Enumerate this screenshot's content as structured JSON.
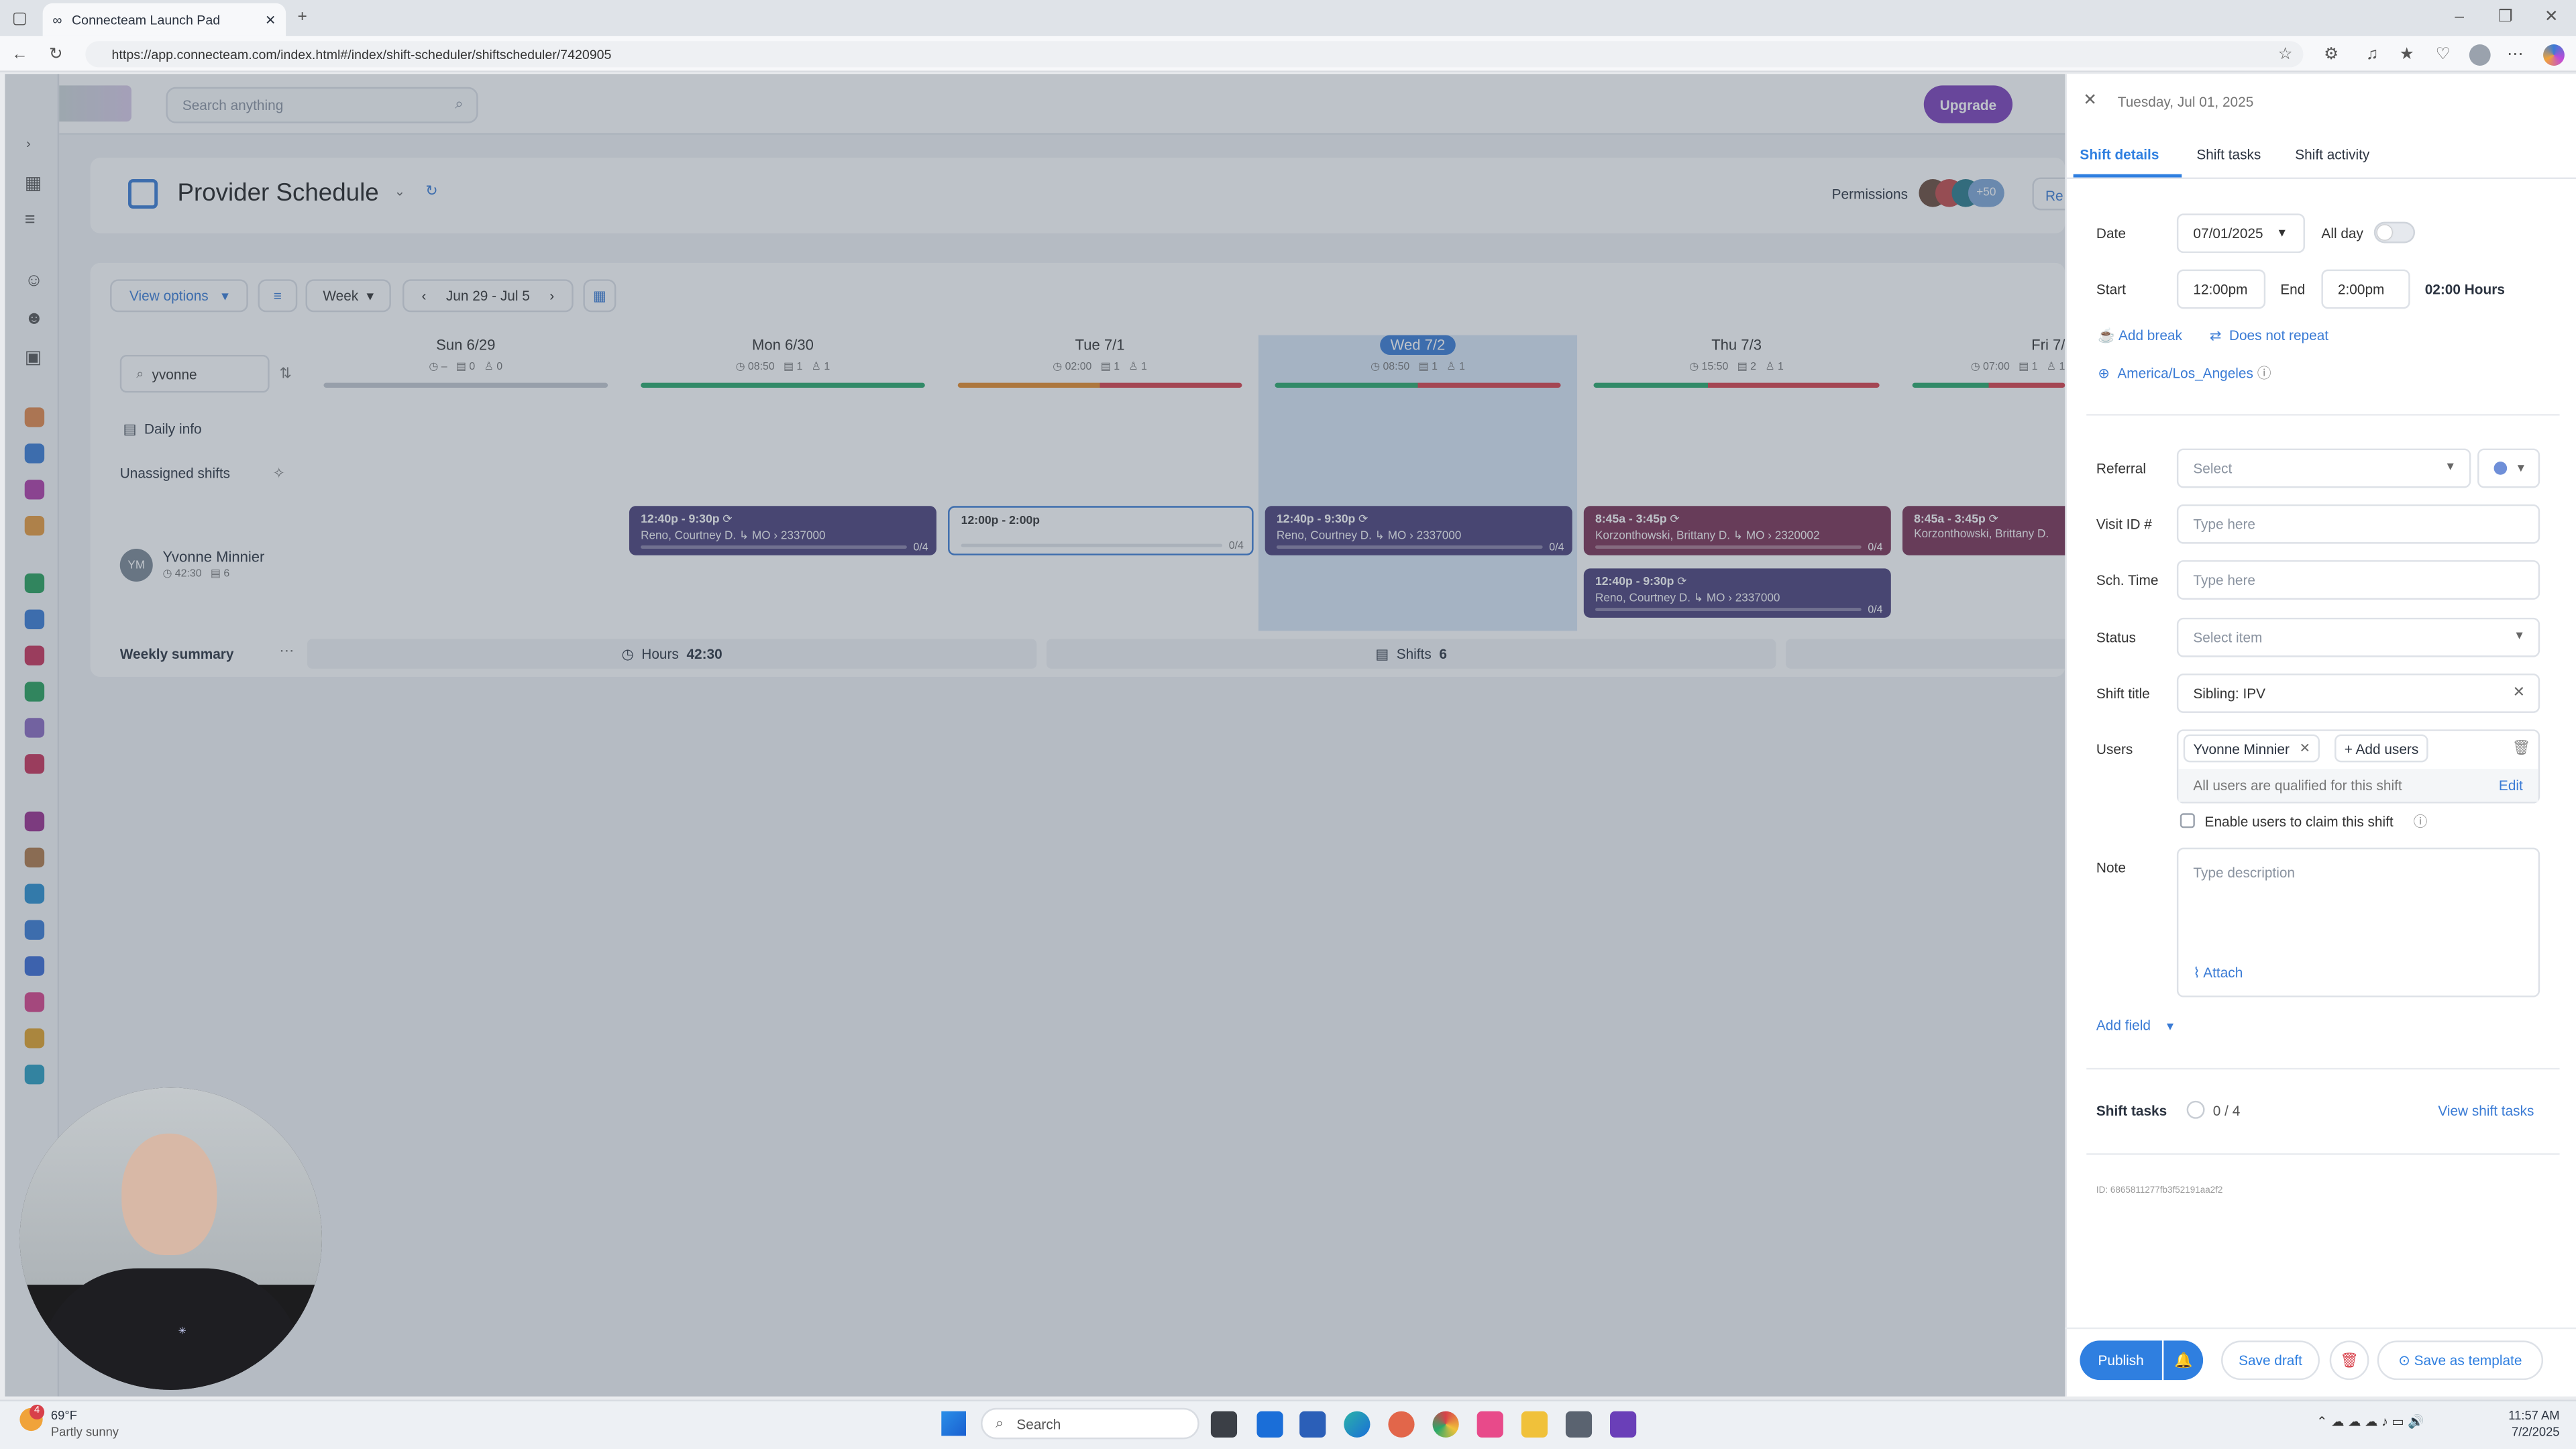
{
  "browser": {
    "tab_title": "Connecteam Launch Pad",
    "url": "https://app.connecteam.com/index.html#/index/shift-scheduler/shiftscheduler/7420905"
  },
  "app": {
    "search_placeholder": "Search anything",
    "upgrade_label": "Upgrade",
    "schedule_title": "Provider Schedule",
    "permissions_label": "Permissions",
    "permissions_more": "+50",
    "view_options_label": "View options",
    "week_label": "Week",
    "date_range": "Jun 29 - Jul 5",
    "user_search_value": "yvonne",
    "daily_info_label": "Daily info",
    "unassigned_label": "Unassigned shifts",
    "user_name": "Yvonne Minnier",
    "user_initials": "YM",
    "user_hours": "42:30",
    "user_shifts": "6",
    "weekly_summary_label": "Weekly summary",
    "hours_label": "Hours",
    "hours_value": "42:30",
    "shifts_label": "Shifts",
    "shifts_value": "6",
    "days": [
      {
        "label": "Sun 6/29",
        "hours": "–",
        "shifts": "0",
        "users": "0"
      },
      {
        "label": "Mon 6/30",
        "hours": "08:50",
        "shifts": "1",
        "users": "1"
      },
      {
        "label": "Tue 7/1",
        "hours": "02:00",
        "shifts": "1",
        "users": "1"
      },
      {
        "label": "Wed 7/2",
        "hours": "08:50",
        "shifts": "1",
        "users": "1"
      },
      {
        "label": "Thu 7/3",
        "hours": "15:50",
        "shifts": "2",
        "users": "1"
      },
      {
        "label": "Fri 7/",
        "hours": "07:00",
        "shifts": "1",
        "users": "1"
      }
    ],
    "shifts": [
      {
        "time": "12:40p - 9:30p",
        "desc": "Reno, Courtney D. ↳ MO › 2337000",
        "count": "0/4"
      },
      {
        "time": "12:00p - 2:00p",
        "desc": "",
        "count": "0/4"
      },
      {
        "time": "12:40p - 9:30p",
        "desc": "Reno, Courtney D. ↳ MO › 2337000",
        "count": "0/4"
      },
      {
        "time": "8:45a - 3:45p",
        "desc": "Korzonthowski, Brittany D. ↳ MO › 2320002",
        "count": "0/4"
      },
      {
        "time": "12:40p - 9:30p",
        "desc": "Reno, Courtney D. ↳ MO › 2337000",
        "count": "0/4"
      },
      {
        "time": "8:45a - 3:45p",
        "desc": "Korzonthowski, Brittany D.",
        "count": ""
      }
    ]
  },
  "panel": {
    "header_date": "Tuesday, Jul 01, 2025",
    "tabs": [
      "Shift details",
      "Shift tasks",
      "Shift activity"
    ],
    "date_label": "Date",
    "date_value": "07/01/2025",
    "all_day_label": "All day",
    "start_label": "Start",
    "start_value": "12:00pm",
    "end_label": "End",
    "end_value": "2:00pm",
    "duration": "02:00 Hours",
    "add_break": "Add break",
    "repeat": "Does not repeat",
    "timezone": "America/Los_Angeles",
    "referral_label": "Referral",
    "referral_placeholder": "Select",
    "visit_label": "Visit ID #",
    "visit_placeholder": "Type here",
    "sch_label": "Sch. Time",
    "sch_placeholder": "Type here",
    "status_label": "Status",
    "status_placeholder": "Select item",
    "title_label": "Shift title",
    "title_value": "Sibling: IPV",
    "users_label": "Users",
    "user_chip": "Yvonne Minnier",
    "add_users": "+ Add users",
    "qualified_text": "All users are qualified for this shift",
    "edit_label": "Edit",
    "claim_label": "Enable users to claim this shift",
    "note_label": "Note",
    "note_placeholder": "Type description",
    "attach_label": "Attach",
    "add_field": "Add field",
    "tasks_label": "Shift tasks",
    "tasks_count": "0 / 4",
    "view_tasks": "View shift tasks",
    "shift_id": "ID: 6865811277fb3f52191aa2f2",
    "publish": "Publish",
    "save_draft": "Save draft",
    "save_template": "Save as template"
  },
  "taskbar": {
    "weather_temp": "69°F",
    "weather_desc": "Partly sunny",
    "weather_badge": "4",
    "search_placeholder": "Search",
    "time": "11:57 AM",
    "date": "7/2/2025"
  },
  "colors": {
    "shift_purple": "#4a3f7a",
    "shift_maroon": "#7a3154",
    "accent_blue": "#2f7fe0",
    "upgrade": "#7b3fb8"
  }
}
